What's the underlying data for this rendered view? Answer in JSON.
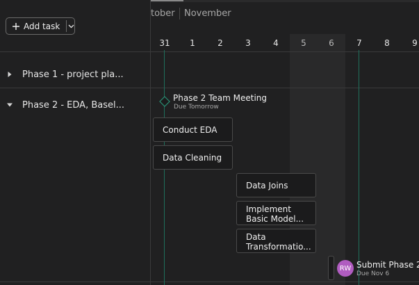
{
  "colors": {
    "background": "#202021",
    "weekend": "#29292a",
    "accent_line": "#1f6f5c",
    "avatar": "#b05cc0"
  },
  "toolbar": {
    "add_task_label": "Add task",
    "plus_icon": "plus-icon",
    "dropdown_icon": "chevron-down-icon"
  },
  "timeline": {
    "months": [
      "tober",
      "November"
    ],
    "days": [
      "31",
      "1",
      "2",
      "3",
      "4",
      "5",
      "6",
      "7",
      "8",
      "9"
    ]
  },
  "groups": [
    {
      "label": "Phase 1 - project pla...",
      "expanded": false
    },
    {
      "label": "Phase 2 - EDA, Basel...",
      "expanded": true
    }
  ],
  "milestones": [
    {
      "title": "Phase 2 Team Meeting",
      "due": "Due Tomorrow"
    }
  ],
  "tasks": [
    {
      "lines": [
        "Conduct EDA"
      ]
    },
    {
      "lines": [
        "Data Cleaning"
      ]
    },
    {
      "lines": [
        "Data Joins"
      ]
    },
    {
      "lines": [
        "Implement",
        "Basic Model..."
      ]
    },
    {
      "lines": [
        "Data",
        "Transformatio..."
      ]
    }
  ],
  "submit": {
    "avatar_initials": "RW",
    "title": "Submit Phase 2",
    "due": "Due Nov 6"
  }
}
